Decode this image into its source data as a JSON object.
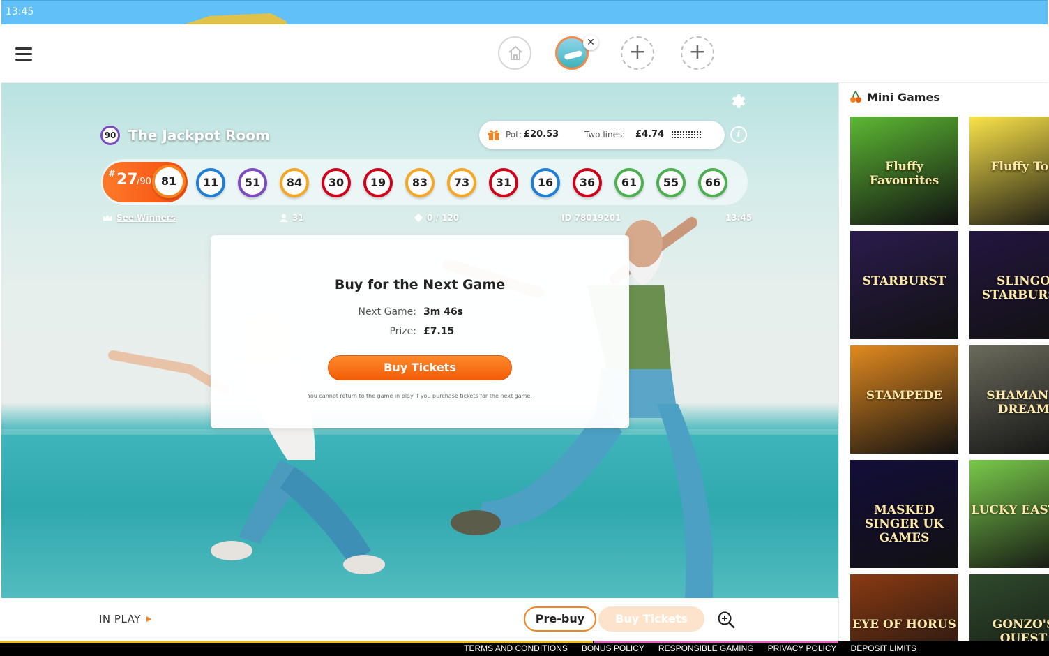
{
  "status_bar": {
    "time": "13:45"
  },
  "header": {
    "home_icon": "home-icon",
    "menu_icon": "hamburger-icon",
    "close_icon": "close-icon",
    "add_icon": "plus-icon",
    "add_label": "+",
    "close_label": "✕"
  },
  "room": {
    "type": "90",
    "name": "The Jackpot Room",
    "pot_label": "Pot:",
    "pot_value": "£20.53",
    "two_lines_label": "Two lines:",
    "two_lines_value": "£4.74",
    "info_label": "i"
  },
  "balls": {
    "count_hash": "#",
    "count": "27",
    "total": "/90",
    "current": {
      "number": "81",
      "color": "#f5821f"
    },
    "called": [
      {
        "number": "11",
        "color": "#1e7fd6"
      },
      {
        "number": "51",
        "color": "#7c4bc0"
      },
      {
        "number": "84",
        "color": "#f5a623"
      },
      {
        "number": "30",
        "color": "#d0021b"
      },
      {
        "number": "19",
        "color": "#d0021b"
      },
      {
        "number": "83",
        "color": "#f5a623"
      },
      {
        "number": "73",
        "color": "#f5a623"
      },
      {
        "number": "31",
        "color": "#d0021b"
      },
      {
        "number": "16",
        "color": "#1e7fd6"
      },
      {
        "number": "36",
        "color": "#d0021b"
      },
      {
        "number": "61",
        "color": "#4caf50"
      },
      {
        "number": "55",
        "color": "#4caf50"
      },
      {
        "number": "66",
        "color": "#4caf50"
      }
    ]
  },
  "meta": {
    "see_winners": "See Winners",
    "players": "31",
    "tickets": "0 / 120",
    "id": "ID 78019201",
    "time": "13:45"
  },
  "modal": {
    "title": "Buy for the Next Game",
    "next_game_label": "Next Game:",
    "next_game_value": "3m 46s",
    "prize_label": "Prize:",
    "prize_value": "£7.15",
    "buy_button": "Buy Tickets",
    "note": "You cannot return to the game in play if you purchase tickets for the next game."
  },
  "bottom_bar": {
    "in_play": "IN PLAY",
    "prebuy": "Pre-buy",
    "buy_tickets": "Buy Tickets"
  },
  "footer": {
    "links": [
      "TERMS AND CONDITIONS",
      "BONUS POLICY",
      "RESPONSIBLE GAMING",
      "PRIVACY POLICY",
      "DEPOSIT LIMITS"
    ]
  },
  "mini_games": {
    "title": "Mini Games",
    "icon": "cherries-icon",
    "games": [
      {
        "name": "Fluffy Favourites",
        "color": "#5cb833"
      },
      {
        "name": "Fluffy Too",
        "color": "#fbe34a"
      },
      {
        "name": "STARBURST",
        "color": "#2b1b4d"
      },
      {
        "name": "SLINGO STARBURST",
        "color": "#241540"
      },
      {
        "name": "STAMPEDE",
        "color": "#e28a1f"
      },
      {
        "name": "SHAMAN'S DREAM",
        "color": "#6a6a5c"
      },
      {
        "name": "MASKED SINGER UK GAMES",
        "color": "#130d3a"
      },
      {
        "name": "LUCKY EASTER",
        "color": "#79c94a"
      },
      {
        "name": "EYE OF HORUS",
        "color": "#8a3a12"
      },
      {
        "name": "GONZO'S QUEST",
        "color": "#2f4a2c"
      }
    ]
  }
}
